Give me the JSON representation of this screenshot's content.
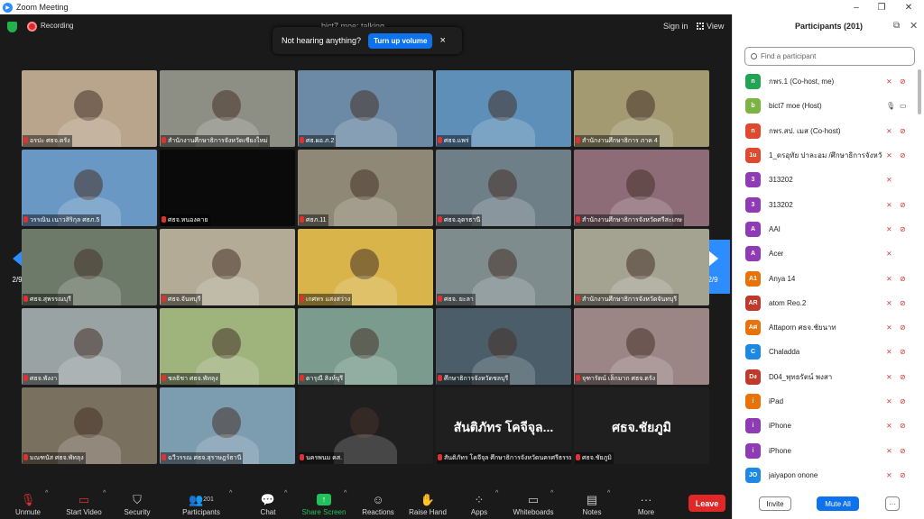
{
  "window": {
    "title": "Zoom Meeting",
    "app_icon": "zoom-icon"
  },
  "topbar": {
    "recording_label": "Recording",
    "talking": "bict7 moe: talking",
    "sign_in": "Sign in",
    "view": "View"
  },
  "toast": {
    "message": "Not hearing anything?",
    "button": "Turn up volume"
  },
  "nav": {
    "page_left": "2/9",
    "page_right": "2/9"
  },
  "tiles": [
    {
      "name": "อรปะ ศธจ.ตรัง",
      "bg": "#b9a48c"
    },
    {
      "name": "สำนักงานศึกษาธิการจังหวัดเชียงใหม่",
      "bg": "#8d8f84"
    },
    {
      "name": "ศธ.ผอ.ภ.2",
      "bg": "#6c8aa5"
    },
    {
      "name": "ศธจ.แพร่",
      "bg": "#5d8fb8"
    },
    {
      "name": "สำนักงานศึกษาธิการ ภาค 4",
      "bg": "#a39a72"
    },
    {
      "name": "วรรณิน เนาวสิริกุล ศธภ.5",
      "bg": "#6a98c4"
    },
    {
      "name": "ศธจ.หนองคาย",
      "bg": "#0a0a0a"
    },
    {
      "name": "ศธภ.11",
      "bg": "#8f8876"
    },
    {
      "name": "ศธจ.อุดรธานี",
      "bg": "#6f7f88"
    },
    {
      "name": "สำนักงานศึกษาธิการจังหวัดศรีสะเกษ",
      "bg": "#8d6c78"
    },
    {
      "name": "ศธจ.สุพรรณบุรี",
      "bg": "#6d7a6a"
    },
    {
      "name": "ศธจ.จันทบุรี",
      "bg": "#b3ab96"
    },
    {
      "name": "เกศทร แสงสว่าง",
      "bg": "#d8b44a"
    },
    {
      "name": "ศธจ. ยะลา",
      "bg": "#7e8c8e"
    },
    {
      "name": "สำนักงานศึกษาธิการจังหวัดจันทบุรี",
      "bg": "#a4a392"
    },
    {
      "name": "ศธจ.พังงา",
      "bg": "#9aa3a4"
    },
    {
      "name": "ชลธิชา ศธจ.พัทลุง",
      "bg": "#9fb37d"
    },
    {
      "name": "ดารุณี สิงห์บุรี",
      "bg": "#7a9b8e"
    },
    {
      "name": "ศึกษาธิการจังหวัดชลบุรี",
      "bg": "#4a5d68"
    },
    {
      "name": "จุฑารัตน์ เล็กมาก ศธจ.ตรัง",
      "bg": "#9c8585"
    },
    {
      "name": "มณฑนัส ศธจ.พัทลุง",
      "bg": "#7a7060"
    },
    {
      "name": "ฉวีวรรณ ศธจ.สุราษฎร์ธานี",
      "bg": "#7c9cb0"
    },
    {
      "name": "นครพนม คส.",
      "bg": "#1f1f1f"
    },
    {
      "name": "สันติภัทร โคจีจุล ศึกษาธิการจังหวัดนครศรีธรรมราช",
      "bg": "#1f1f1f",
      "big": "สันติภัทร โคจีจุล..."
    },
    {
      "name": "ศธจ.ชัยภูมิ",
      "bg": "#1f1f1f",
      "big": "ศธจ.ชัยภูมิ"
    }
  ],
  "toolbar": {
    "unmute": "Unmute",
    "start_video": "Start Video",
    "security": "Security",
    "participants": "Participants",
    "participants_count": "201",
    "chat": "Chat",
    "share_screen": "Share Screen",
    "reactions": "Reactions",
    "raise_hand": "Raise Hand",
    "apps": "Apps",
    "whiteboards": "Whiteboards",
    "notes": "Notes",
    "more": "More",
    "leave": "Leave"
  },
  "panel": {
    "title": "Participants (201)",
    "search_placeholder": "Find a participant",
    "invite": "Invite",
    "mute_all": "Mute All",
    "more": "···",
    "participants": [
      {
        "initials": "n",
        "name": "กพร.1 (Co-host, me)",
        "color": "#23a455",
        "mic": "muted",
        "video": "off"
      },
      {
        "initials": "b",
        "name": "bict7 moe (Host)",
        "color": "#7cb342",
        "mic": "on",
        "video": "on"
      },
      {
        "initials": "n",
        "name": "กพร.สป. เมส (Co-host)",
        "color": "#e0492d",
        "mic": "muted",
        "video": "off"
      },
      {
        "initials": "1u",
        "name": "1_ดรอุทัย ปาละอม /ศึกษาธิการจังหวัด...",
        "color": "#e0492d",
        "mic": "muted",
        "video": "off"
      },
      {
        "initials": "3",
        "name": "313202",
        "color": "#8e3bb5",
        "mic": "muted",
        "video": ""
      },
      {
        "initials": "3",
        "name": "313202",
        "color": "#8e3bb5",
        "mic": "muted",
        "video": "off"
      },
      {
        "initials": "A",
        "name": "AAI",
        "color": "#8e3bb5",
        "mic": "muted",
        "video": "off"
      },
      {
        "initials": "A",
        "name": "Acer",
        "color": "#8e3bb5",
        "mic": "muted",
        "video": ""
      },
      {
        "initials": "A1",
        "name": "Anya 14",
        "color": "#e8730a",
        "mic": "muted",
        "video": "off"
      },
      {
        "initials": "AR",
        "name": "atom Reo.2",
        "color": "#c0392b",
        "mic": "muted",
        "video": "off"
      },
      {
        "initials": "Aศ",
        "name": "Attaporn ศธจ.ชัยนาท",
        "color": "#e8730a",
        "mic": "muted",
        "video": "off"
      },
      {
        "initials": "C",
        "name": "Chaladda",
        "color": "#1e88e5",
        "mic": "muted",
        "video": "off"
      },
      {
        "initials": "Dง",
        "name": "D04_พุทธรัตน์ พงสา",
        "color": "#c0392b",
        "mic": "muted",
        "video": "off"
      },
      {
        "initials": "i",
        "name": "iPad",
        "color": "#e8730a",
        "mic": "muted",
        "video": "off"
      },
      {
        "initials": "i",
        "name": "iPhone",
        "color": "#8e3bb5",
        "mic": "muted",
        "video": "off"
      },
      {
        "initials": "i",
        "name": "iPhone",
        "color": "#8e3bb5",
        "mic": "muted",
        "video": "off"
      },
      {
        "initials": "JO",
        "name": "jaiyapon onone",
        "color": "#1e88e5",
        "mic": "muted",
        "video": "off"
      }
    ]
  }
}
